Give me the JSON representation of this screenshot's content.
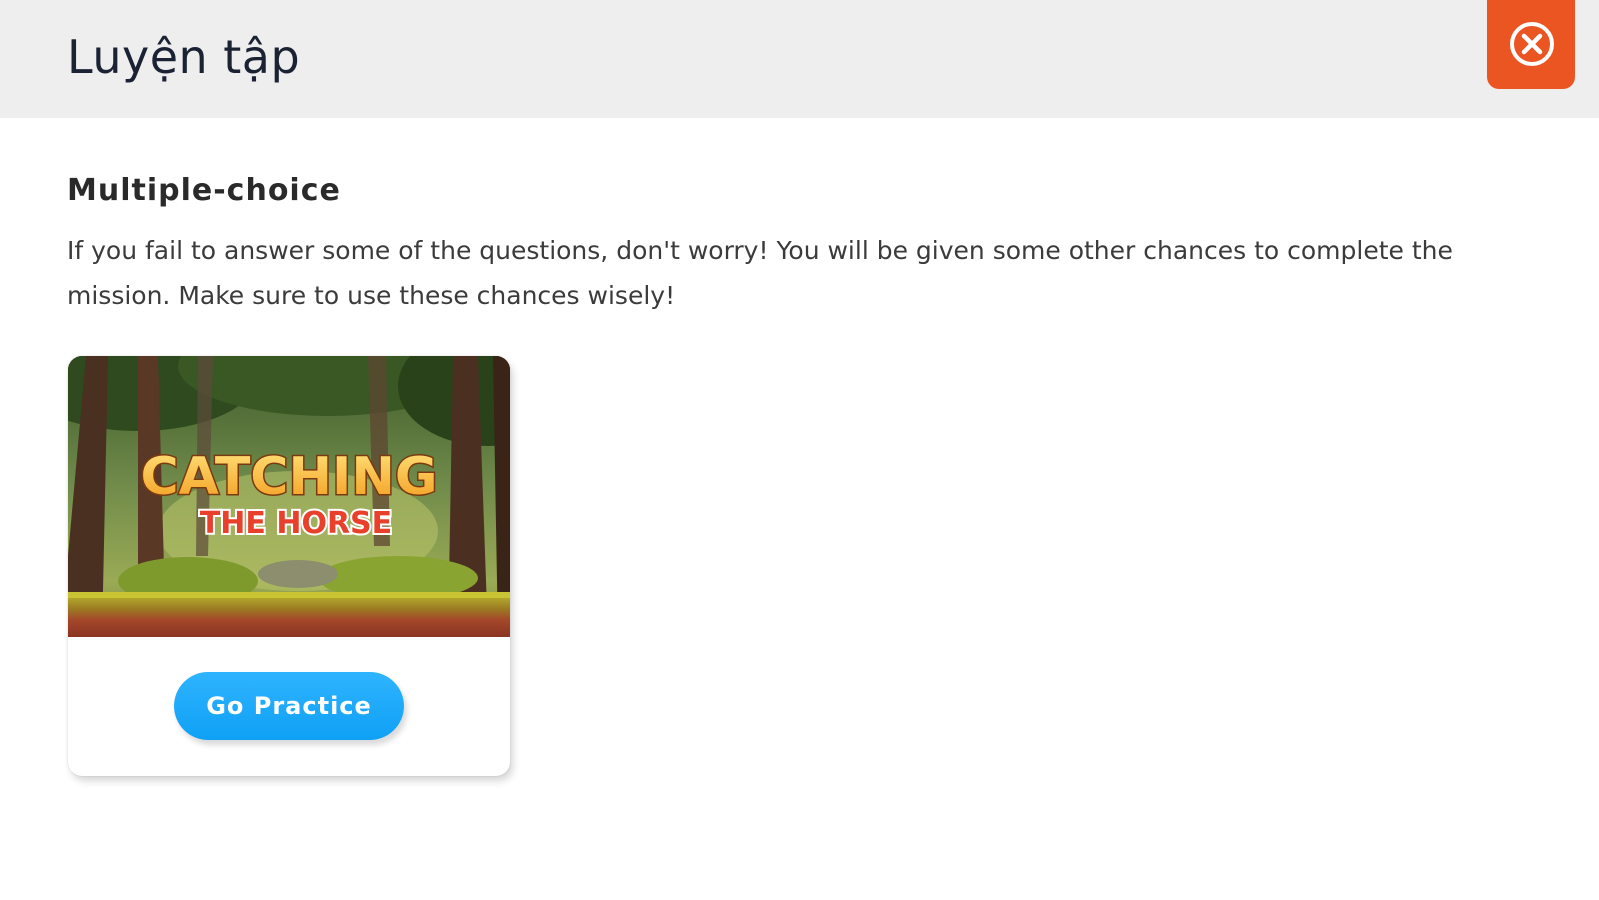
{
  "header": {
    "title": "Luyện tập"
  },
  "close_icon": "close-x-icon",
  "section": {
    "title": "Multiple-choice",
    "description": "If you fail to answer some of the questions, don't worry! You will be given some other chances to complete the mission. Make sure to use these chances wisely!"
  },
  "game_card": {
    "image_title_line1": "CATCHING",
    "image_title_line2": "THE HORSE",
    "button_label": "Go Practice"
  },
  "colors": {
    "close_button": "#ea5522",
    "primary_button": "#1aa8fa",
    "header_background": "#eeeeee"
  }
}
